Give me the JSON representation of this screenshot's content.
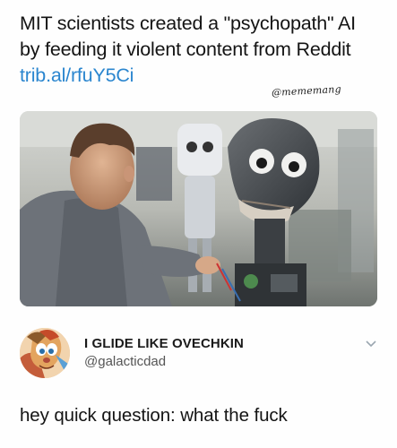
{
  "post": {
    "headline": "MIT scientists created a \"psychopath\" AI by feeding it violent content from Reddit",
    "link_text": "trib.al/rfuY5Ci",
    "watermark": "@mememang"
  },
  "photo": {
    "description_icon": "robot-head-photo"
  },
  "reply": {
    "display_name": "I GLIDE LIKE OVECHKIN",
    "handle": "@galacticdad",
    "text": "hey quick question: what the fuck"
  },
  "colors": {
    "link": "#2b86cf",
    "text": "#141414",
    "handle": "#555555"
  }
}
